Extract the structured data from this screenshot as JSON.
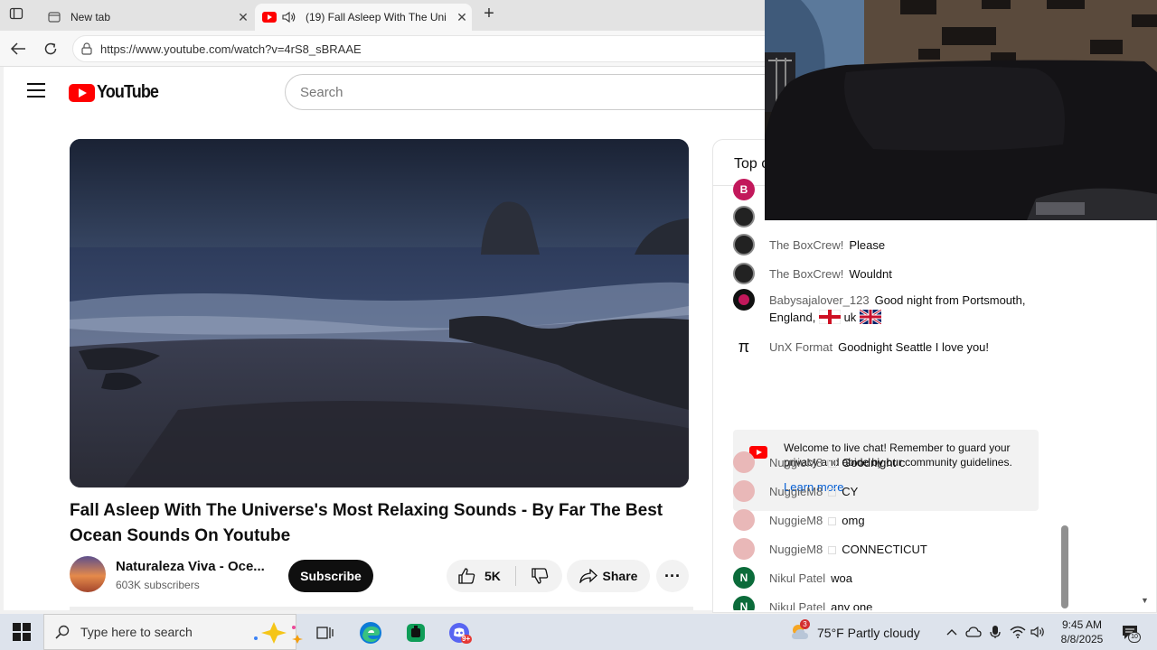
{
  "browser": {
    "tabs": [
      {
        "label": "New tab"
      },
      {
        "label": "(19) Fall Asleep With The Uni"
      }
    ],
    "url": "https://www.youtube.com/watch?v=4rS8_sBRAAE"
  },
  "youtube": {
    "logo_text": "YouTube",
    "search_placeholder": "Search",
    "video": {
      "title": "Fall Asleep With The Universe's Most Relaxing Sounds - By Far The Best Ocean Sounds On Youtube",
      "channel_name": "Naturaleza Viva - Oce...",
      "subscribers": "603K subscribers",
      "subscribe_label": "Subscribe",
      "like_count": "5K",
      "share_label": "Share"
    },
    "chat": {
      "header": "Top c",
      "messages": [
        {
          "author": "",
          "text": "",
          "avatar": "B"
        },
        {
          "author": "",
          "text": ""
        },
        {
          "author": "The BoxCrew!",
          "text": "Please"
        },
        {
          "author": "The BoxCrew!",
          "text": "Wouldnt"
        },
        {
          "author": "Babysajalover_123",
          "text": "Good night from Portsmouth,",
          "text2": "England,",
          "text3": "uk"
        },
        {
          "author": "UnX Format",
          "text": "Goodnight Seattle I love you!"
        },
        {
          "author": "NuggieM8",
          "text": "Goodnight c"
        },
        {
          "author": "NuggieM8",
          "text": "CY"
        },
        {
          "author": "NuggieM8",
          "text": "omg"
        },
        {
          "author": "NuggieM8",
          "text": "CONNECTICUT"
        },
        {
          "author": "Nikul Patel",
          "text": "woa",
          "avatar": "N"
        },
        {
          "author": "Nikul Patel",
          "text": "any one",
          "avatar": "N"
        }
      ],
      "welcome": {
        "text": "Welcome to live chat! Remember to guard your privacy and abide by our community guidelines.",
        "link": "Learn more"
      }
    }
  },
  "taskbar": {
    "search_placeholder": "Type here to search",
    "weather_badge": "3",
    "weather": "75°F  Partly cloudy",
    "time": "9:45 AM",
    "date": "8/8/2025",
    "notification_count": "10",
    "discord_badge": "9+"
  },
  "colors": {
    "yt_red": "#ff0000",
    "link_blue": "#065fd4",
    "subscribe_bg": "#0f0f0f"
  }
}
